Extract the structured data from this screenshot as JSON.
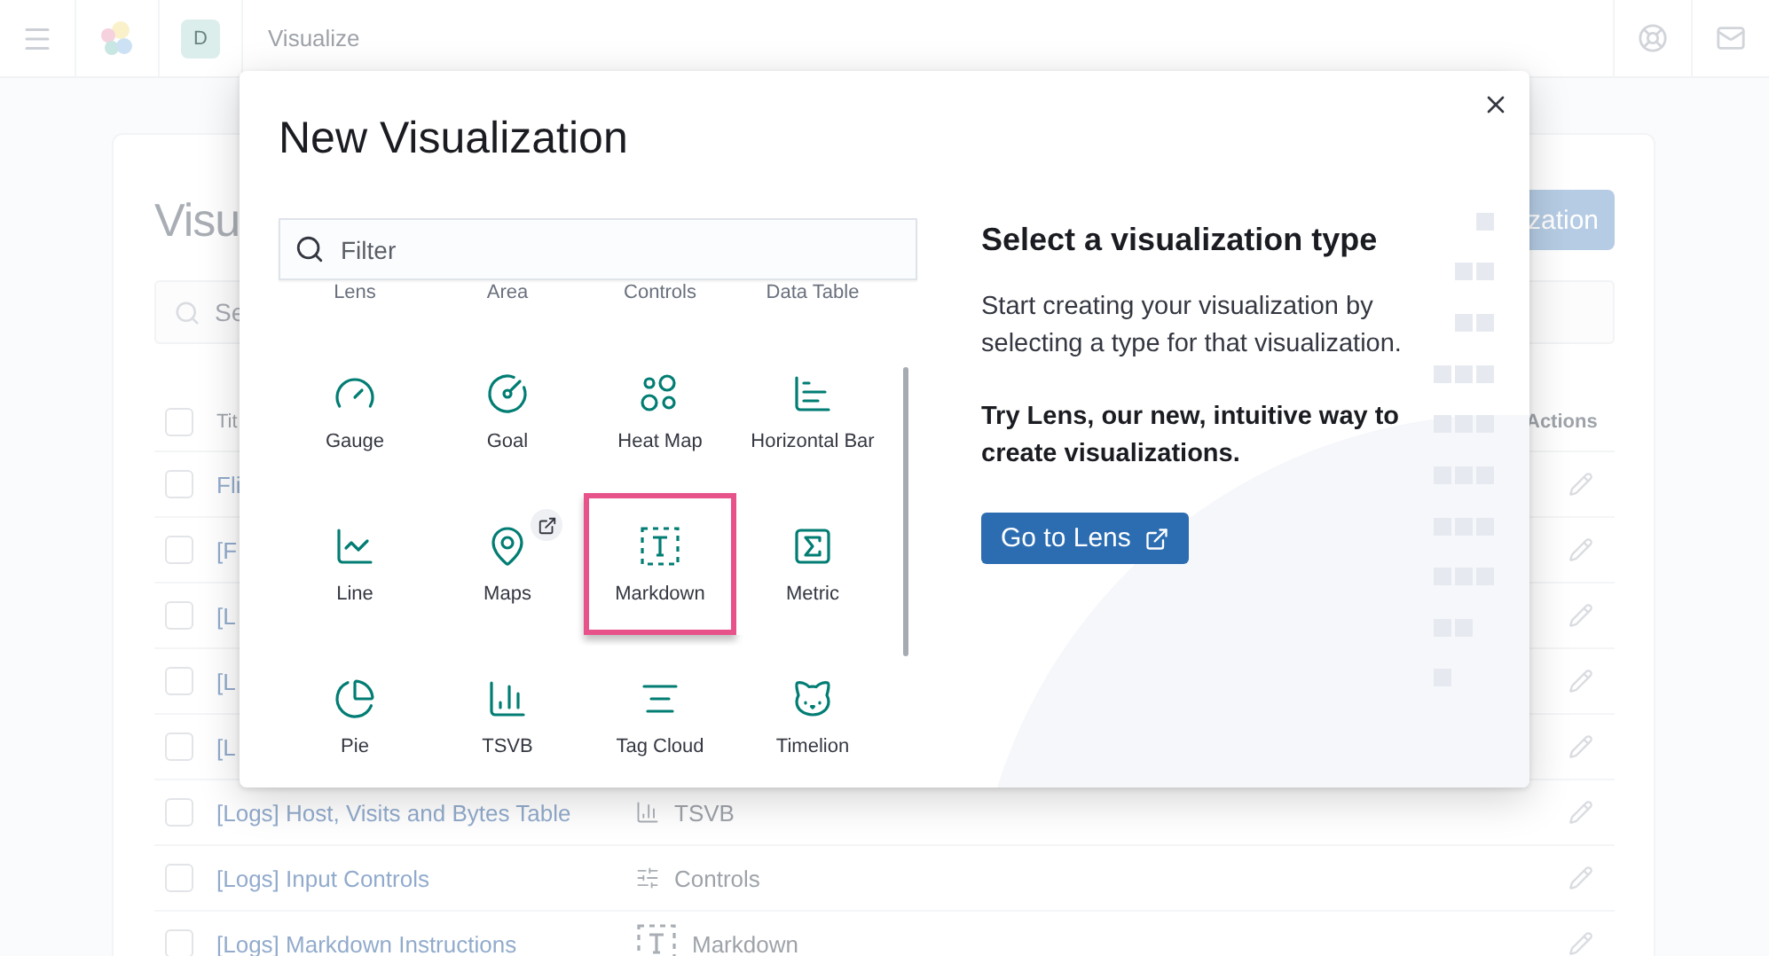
{
  "header": {
    "avatar": "D",
    "title": "Visualize"
  },
  "page": {
    "title": "Visu",
    "search_placeholder": "Se",
    "create_button": "zation",
    "select_all_checked": false,
    "columns": {
      "title": "Tit",
      "actions": "Actions"
    },
    "rows": [
      {
        "title": "Fli",
        "checked": false
      },
      {
        "title": "[F",
        "checked": false
      },
      {
        "title": "[L",
        "checked": false
      },
      {
        "title": "[L",
        "checked": false
      },
      {
        "title": "[L",
        "checked": false
      },
      {
        "title": "[Logs] Host, Visits and Bytes Table",
        "type": "TSVB",
        "kind": "tsvb",
        "checked": false
      },
      {
        "title": "[Logs] Input Controls",
        "type": "Controls",
        "kind": "controls",
        "checked": false
      },
      {
        "title": "[Logs] Markdown Instructions",
        "type": "Markdown",
        "kind": "markdown",
        "checked": false
      }
    ]
  },
  "modal": {
    "title": "New Visualization",
    "filter_placeholder": "Filter",
    "scrolled_labels": [
      "Lens",
      "Area",
      "Controls",
      "Data Table"
    ],
    "types": [
      {
        "label": "Gauge",
        "kind": "gauge",
        "selected": false,
        "external": false
      },
      {
        "label": "Goal",
        "kind": "goal",
        "selected": false,
        "external": false
      },
      {
        "label": "Heat Map",
        "kind": "heatmap",
        "selected": false,
        "external": false
      },
      {
        "label": "Horizontal Bar",
        "kind": "hbar",
        "selected": false,
        "external": false
      },
      {
        "label": "Line",
        "kind": "line",
        "selected": false,
        "external": false
      },
      {
        "label": "Maps",
        "kind": "maps",
        "selected": false,
        "external": true
      },
      {
        "label": "Markdown",
        "kind": "markdown",
        "selected": true,
        "external": false
      },
      {
        "label": "Metric",
        "kind": "metric",
        "selected": false,
        "external": false
      },
      {
        "label": "Pie",
        "kind": "pie",
        "selected": false,
        "external": false
      },
      {
        "label": "TSVB",
        "kind": "tsvb",
        "selected": false,
        "external": false
      },
      {
        "label": "Tag Cloud",
        "kind": "tagcloud",
        "selected": false,
        "external": false
      },
      {
        "label": "Timelion",
        "kind": "timelion",
        "selected": false,
        "external": false
      }
    ],
    "info": {
      "heading": "Select a visualization type",
      "text": "Start creating your visualization by selecting a type for that visualization.",
      "promo": "Try Lens, our new, intuitive way to create visualizations.",
      "button": "Go to Lens"
    }
  }
}
